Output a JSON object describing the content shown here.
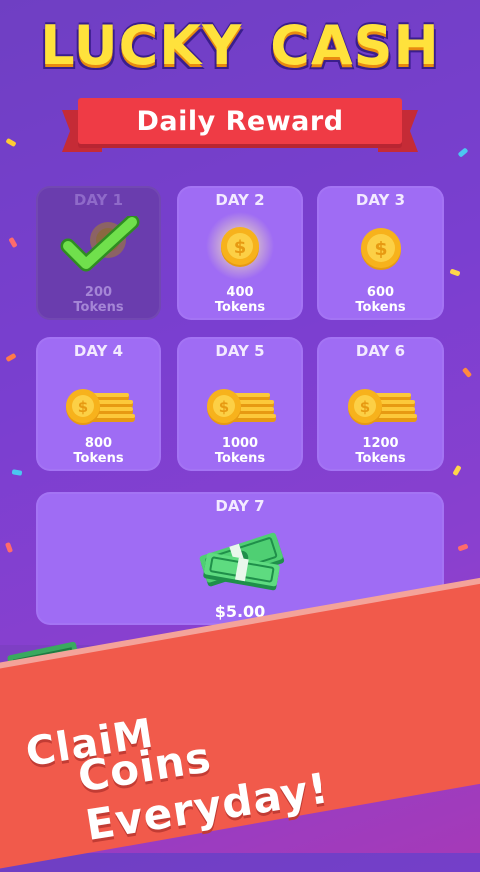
{
  "app": {
    "title_word1": "LUCKY",
    "title_word2": "CASH",
    "banner": "Daily Reward",
    "slogan_line1": "ClaiM",
    "slogan_line2": "Coins Everyday!"
  },
  "rewards": [
    {
      "day": "DAY 1",
      "amount": "200",
      "unit": "Tokens",
      "status": "claimed"
    },
    {
      "day": "DAY 2",
      "amount": "400",
      "unit": "Tokens",
      "status": "current"
    },
    {
      "day": "DAY 3",
      "amount": "600",
      "unit": "Tokens",
      "status": "locked"
    },
    {
      "day": "DAY 4",
      "amount": "800",
      "unit": "Tokens",
      "status": "locked"
    },
    {
      "day": "DAY 5",
      "amount": "1000",
      "unit": "Tokens",
      "status": "locked"
    },
    {
      "day": "DAY 6",
      "amount": "1200",
      "unit": "Tokens",
      "status": "locked"
    },
    {
      "day": "DAY 7",
      "amount": "$5.00",
      "status": "locked"
    }
  ],
  "icons": {
    "day1": "coin-with-check-icon",
    "day2": "glowing-coin-icon",
    "day3": "coin-icon",
    "day4_6": "coin-stack-icon",
    "day7": "cash-bundle-icon"
  },
  "colors": {
    "background": "#7a3fd0",
    "card": "#9f6cf4",
    "card_claimed": "#6a3dae",
    "title": "#ffe23c",
    "banner": "#ef3b45",
    "ribbon": "#f15a4b",
    "check": "#6ee04a",
    "coin": "#f7b21c"
  }
}
